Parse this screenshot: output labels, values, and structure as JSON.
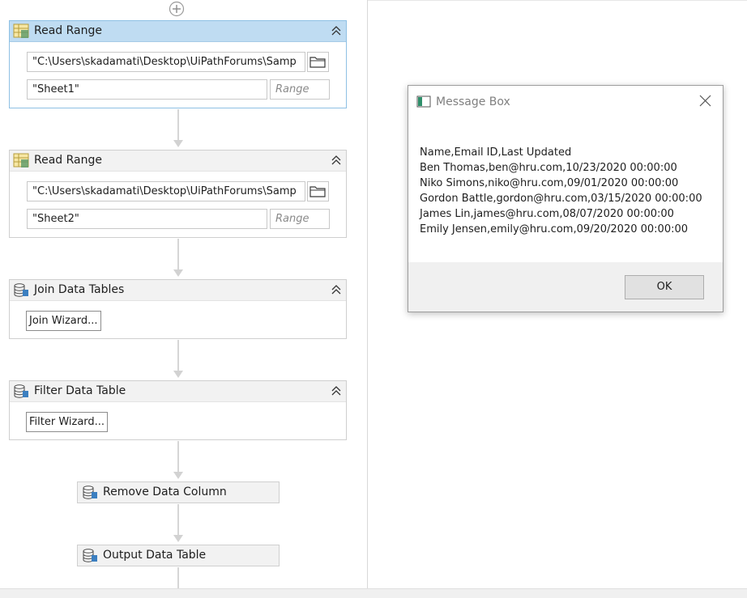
{
  "workflow": {
    "read_range_1": {
      "title": "Read Range",
      "path": "\"C:\\Users\\skadamati\\Desktop\\UiPathForums\\Samp",
      "sheet": "\"Sheet1\"",
      "range_placeholder": "Range"
    },
    "read_range_2": {
      "title": "Read Range",
      "path": "\"C:\\Users\\skadamati\\Desktop\\UiPathForums\\Samp",
      "sheet": "\"Sheet2\"",
      "range_placeholder": "Range"
    },
    "join_data_tables": {
      "title": "Join Data Tables",
      "button": "Join Wizard..."
    },
    "filter_data_table": {
      "title": "Filter Data Table",
      "button": "Filter Wizard..."
    },
    "remove_data_column": {
      "title": "Remove Data Column"
    },
    "output_data_table": {
      "title": "Output Data Table"
    }
  },
  "message_box": {
    "title": "Message Box",
    "lines": [
      "Name,Email ID,Last Updated",
      "Ben Thomas,ben@hru.com,10/23/2020 00:00:00",
      "Niko Simons,niko@hru.com,09/01/2020 00:00:00",
      "Gordon Battle,gordon@hru.com,03/15/2020 00:00:00",
      "James Lin,james@hru.com,08/07/2020 00:00:00",
      "Emily Jensen,emily@hru.com,09/20/2020 00:00:00"
    ],
    "ok_label": "OK"
  },
  "colors": {
    "selected_header": "#bfdcf2",
    "selected_border": "#8ec0e4",
    "connector": "#d6d6d6"
  },
  "icons": {
    "add": "add-activity-icon",
    "excel_activity": "excel-range-icon",
    "datatable_activity": "datatable-icon",
    "collapse": "collapse-icon",
    "folder": "folder-icon",
    "window": "window-icon",
    "close": "close-icon"
  }
}
